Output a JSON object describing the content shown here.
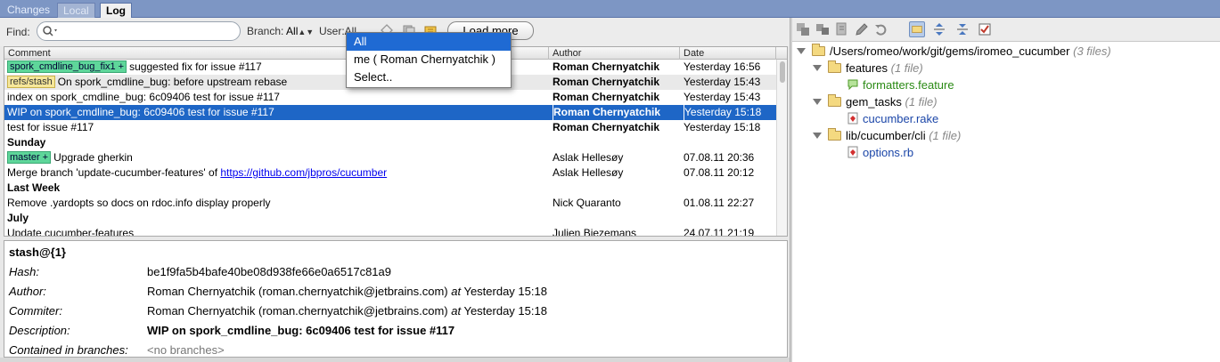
{
  "tabs": {
    "changes": "Changes",
    "local": "Local",
    "log": "Log"
  },
  "toolbar": {
    "find_label": "Find:",
    "branch_label": "Branch:",
    "branch_value": "All",
    "user_label": "User:",
    "user_value": "All",
    "load_more": "Load more"
  },
  "table": {
    "columns": [
      "Comment",
      "Author",
      "Date"
    ],
    "rows": [
      {
        "tag": "spork_cmdline_bug_fix1 +",
        "tag_color": "green",
        "comment": "suggested fix for issue #117",
        "author": "Roman Chernyatchik",
        "date": "Yesterday 16:56",
        "author_bold": true
      },
      {
        "tag": "refs/stash",
        "tag_color": "yellow",
        "comment": "On spork_cmdline_bug: before upstream rebase",
        "author": "Roman Chernyatchik",
        "date": "Yesterday 15:43",
        "author_bold": true,
        "gray": true
      },
      {
        "comment": "index on spork_cmdline_bug: 6c09406 test for issue #117",
        "author": "Roman Chernyatchik",
        "date": "Yesterday 15:43",
        "author_bold": true
      },
      {
        "comment": "WIP on spork_cmdline_bug: 6c09406 test for issue #117",
        "author": "Roman Chernyatchik",
        "date": "Yesterday 15:18",
        "author_bold": true,
        "selected": true
      },
      {
        "comment": "test for issue #117",
        "author": "Roman Chernyatchik",
        "date": "Yesterday 15:18",
        "author_bold": true
      },
      {
        "section": "Sunday"
      },
      {
        "tag": "master +",
        "tag_color": "green",
        "comment": "Upgrade gherkin",
        "author": "Aslak Hellesøy",
        "date": "07.08.11 20:36"
      },
      {
        "comment": "Merge branch 'update-cucumber-features' of ",
        "link": "https://github.com/jbpros/cucumber",
        "author": "Aslak Hellesøy",
        "date": "07.08.11 20:12"
      },
      {
        "section": "Last Week"
      },
      {
        "comment": "Remove .yardopts so docs on rdoc.info display properly",
        "author": "Nick Quaranto",
        "date": "01.08.11 22:27"
      },
      {
        "section": "July"
      },
      {
        "comment": "Update cucumber-features",
        "author": "Julien Biezemans",
        "date": "24.07.11 21:19"
      }
    ]
  },
  "dropdown": {
    "items": [
      "All",
      "me ( Roman Chernyatchik )",
      "Select.."
    ],
    "selected": 0
  },
  "details": {
    "title": "stash@{1}",
    "hash_label": "Hash:",
    "hash": "be1f9fa5b4bafe40be08d938fe66e0a6517c81a9",
    "author_label": "Author:",
    "author": "Roman Chernyatchik (roman.chernyatchik@jetbrains.com)",
    "at": "at",
    "author_time": "Yesterday 15:18",
    "commiter_label": "Commiter:",
    "commiter": "Roman Chernyatchik (roman.chernyatchik@jetbrains.com)",
    "commiter_time": "Yesterday 15:18",
    "description_label": "Description:",
    "description": "WIP on spork_cmdline_bug: 6c09406 test for issue #117",
    "branches_label": "Contained in branches:",
    "branches": "<no branches>"
  },
  "tree": {
    "root": {
      "path": "/Users/romeo/work/git/gems/iromeo_cucumber",
      "count": "(3 files)"
    },
    "folders": [
      {
        "name": "features",
        "count": "(1 file)",
        "file": "formatters.feature",
        "file_color": "green",
        "file_icon": "feature-file-icon"
      },
      {
        "name": "gem_tasks",
        "count": "(1 file)",
        "file": "cucumber.rake",
        "file_color": "blue",
        "file_icon": "ruby-file-icon"
      },
      {
        "name": "lib/cucumber/cli",
        "count": "(1 file)",
        "file": "options.rb",
        "file_color": "blue",
        "file_icon": "ruby-file-icon"
      }
    ]
  },
  "colors": {
    "selection": "#1e66c6",
    "tag_green": "#5ed69a",
    "tag_yellow": "#f6e79a",
    "file_green": "#2a8a14",
    "file_blue": "#1b46a8"
  }
}
